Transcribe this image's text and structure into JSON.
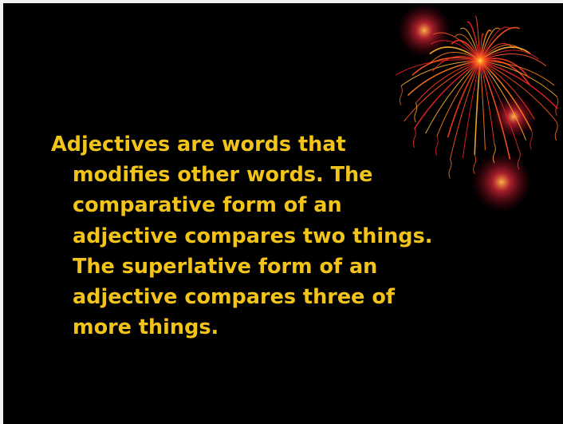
{
  "slide": {
    "background_color": "#000000",
    "text_color": "#f2c41a",
    "decoration": "firework-burst",
    "body_lines": [
      "Adjectives are words that",
      "modifies other words. The",
      "comparative form of an",
      "adjective compares two things.",
      "The superlative form of an",
      "adjective compares three of",
      "more things."
    ]
  }
}
